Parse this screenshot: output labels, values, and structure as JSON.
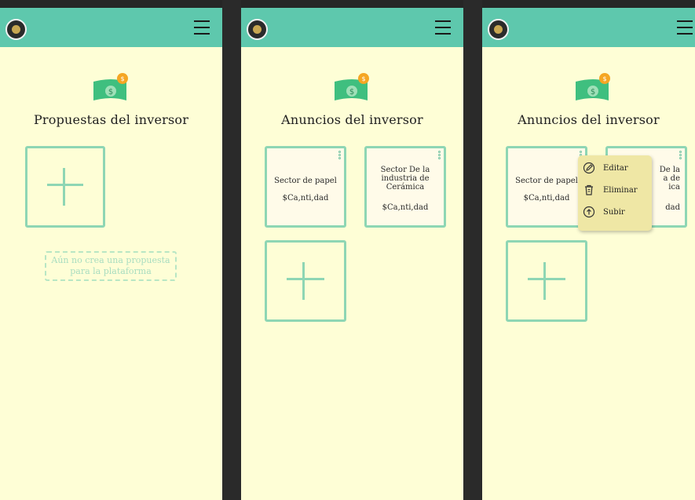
{
  "colors": {
    "header": "#5ec8ad",
    "background": "#fefed6",
    "accent": "#8ed6b4",
    "popup": "#efe7a5"
  },
  "screens": [
    {
      "title": "Propuestas del inversor",
      "empty_message": "Aún no crea una propuesta para la plataforma"
    },
    {
      "title": "Anuncios del inversor",
      "cards": [
        {
          "name": "Sector de papel",
          "amount": "$Ca,nti,dad"
        },
        {
          "name": "Sector De la industria de Cerámica",
          "amount": "$Ca,nti,dad"
        }
      ]
    },
    {
      "title": "Anuncios del inversor",
      "cards": [
        {
          "name": "Sector de papel",
          "amount": "$Ca,nti,dad"
        },
        {
          "name_partial_lines": [
            "De la",
            "a de",
            "ica"
          ],
          "amount_partial": "dad"
        }
      ],
      "context_menu": {
        "items": [
          {
            "label": "Editar",
            "icon": "edit-icon"
          },
          {
            "label": "Eliminar",
            "icon": "trash-icon"
          },
          {
            "label": "Subir",
            "icon": "upload-icon"
          }
        ]
      }
    }
  ],
  "icons": {
    "logo": "logo-icon",
    "menu": "hamburger-menu-icon",
    "money": "money-bill-icon",
    "add": "plus-icon"
  }
}
